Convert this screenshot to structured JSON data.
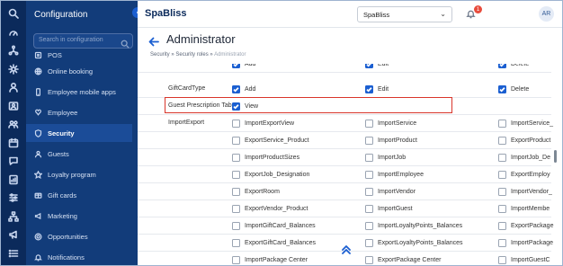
{
  "app": {
    "logo": "SpaBliss",
    "org_selected": "SpaBliss",
    "notification_count": "1",
    "avatar_initials": "AR"
  },
  "rail": [
    "search-icon",
    "dashboard-icon",
    "network-icon",
    "settings-icon",
    "user-icon",
    "profile-card-icon",
    "groups-icon",
    "calendar-icon",
    "chat-icon",
    "report-icon",
    "sliders-icon",
    "hierarchy-icon",
    "megaphone-icon",
    "list-icon"
  ],
  "nav": {
    "title": "Configuration",
    "search_placeholder": "Search in configuration",
    "items": [
      {
        "label": "POS",
        "icon": "pos-icon"
      },
      {
        "label": "Online booking",
        "icon": "globe-icon"
      },
      {
        "label": "Employee mobile apps",
        "icon": "mobile-icon"
      },
      {
        "label": "Employee",
        "icon": "employee-icon"
      },
      {
        "label": "Security",
        "icon": "shield-icon",
        "active": true
      },
      {
        "label": "Guests",
        "icon": "guests-icon"
      },
      {
        "label": "Loyalty program",
        "icon": "loyalty-icon"
      },
      {
        "label": "Gift cards",
        "icon": "gift-card-icon"
      },
      {
        "label": "Marketing",
        "icon": "marketing-icon"
      },
      {
        "label": "Opportunities",
        "icon": "opportunities-icon"
      },
      {
        "label": "Notifications",
        "icon": "notifications-icon"
      }
    ]
  },
  "page": {
    "title": "Administrator",
    "breadcrumb": [
      "Security",
      "Security roles",
      "Administrator"
    ]
  },
  "permissions": {
    "rows": [
      {
        "label": "",
        "partial": true,
        "items": [
          {
            "label": "Add",
            "checked": true
          },
          {
            "label": "Edit",
            "checked": true
          },
          {
            "label": "Delete",
            "checked": true
          }
        ]
      },
      {
        "label": "GiftCardType",
        "items": [
          {
            "label": "Add",
            "checked": true
          },
          {
            "label": "Edit",
            "checked": true
          },
          {
            "label": "Delete",
            "checked": true
          }
        ]
      },
      {
        "label": "Guest Prescription Tab",
        "highlighted": true,
        "items": [
          {
            "label": "View",
            "checked": true
          }
        ]
      },
      {
        "label": "ImportExport",
        "items": [
          {
            "label": "ImportExportView",
            "checked": false
          },
          {
            "label": "ImportService",
            "checked": false
          },
          {
            "label": "ImportService_",
            "checked": false
          }
        ]
      },
      {
        "label": "",
        "items": [
          {
            "label": "ExportService_Product",
            "checked": false
          },
          {
            "label": "ImportProduct",
            "checked": false
          },
          {
            "label": "ExportProduct",
            "checked": false
          }
        ]
      },
      {
        "label": "",
        "items": [
          {
            "label": "ImportProductSizes",
            "checked": false
          },
          {
            "label": "ImportJob",
            "checked": false
          },
          {
            "label": "ImportJob_De",
            "checked": false
          }
        ]
      },
      {
        "label": "",
        "items": [
          {
            "label": "ExportJob_Designation",
            "checked": false
          },
          {
            "label": "ImportEmployee",
            "checked": false
          },
          {
            "label": "ExportEmploy",
            "checked": false
          }
        ]
      },
      {
        "label": "",
        "items": [
          {
            "label": "ExportRoom",
            "checked": false
          },
          {
            "label": "ImportVendor",
            "checked": false
          },
          {
            "label": "ImportVendor_",
            "checked": false
          }
        ]
      },
      {
        "label": "",
        "items": [
          {
            "label": "ExportVendor_Product",
            "checked": false
          },
          {
            "label": "ImportGuest",
            "checked": false
          },
          {
            "label": "ImportMembe",
            "checked": false
          }
        ]
      },
      {
        "label": "",
        "items": [
          {
            "label": "ImportGiftCard_Balances",
            "checked": false
          },
          {
            "label": "ImportLoyaltyPoints_Balances",
            "checked": false
          },
          {
            "label": "ExportPackage",
            "checked": false
          }
        ]
      },
      {
        "label": "",
        "items": [
          {
            "label": "ExportGiftCard_Balances",
            "checked": false
          },
          {
            "label": "ExportLoyaltyPoints_Balances",
            "checked": false
          },
          {
            "label": "ImportPackage",
            "checked": false
          }
        ]
      },
      {
        "label": "",
        "items": [
          {
            "label": "ImportPackage Center",
            "checked": false
          },
          {
            "label": "ExportPackage Center",
            "checked": false
          },
          {
            "label": "ImportGuestC",
            "checked": false
          }
        ]
      }
    ]
  }
}
